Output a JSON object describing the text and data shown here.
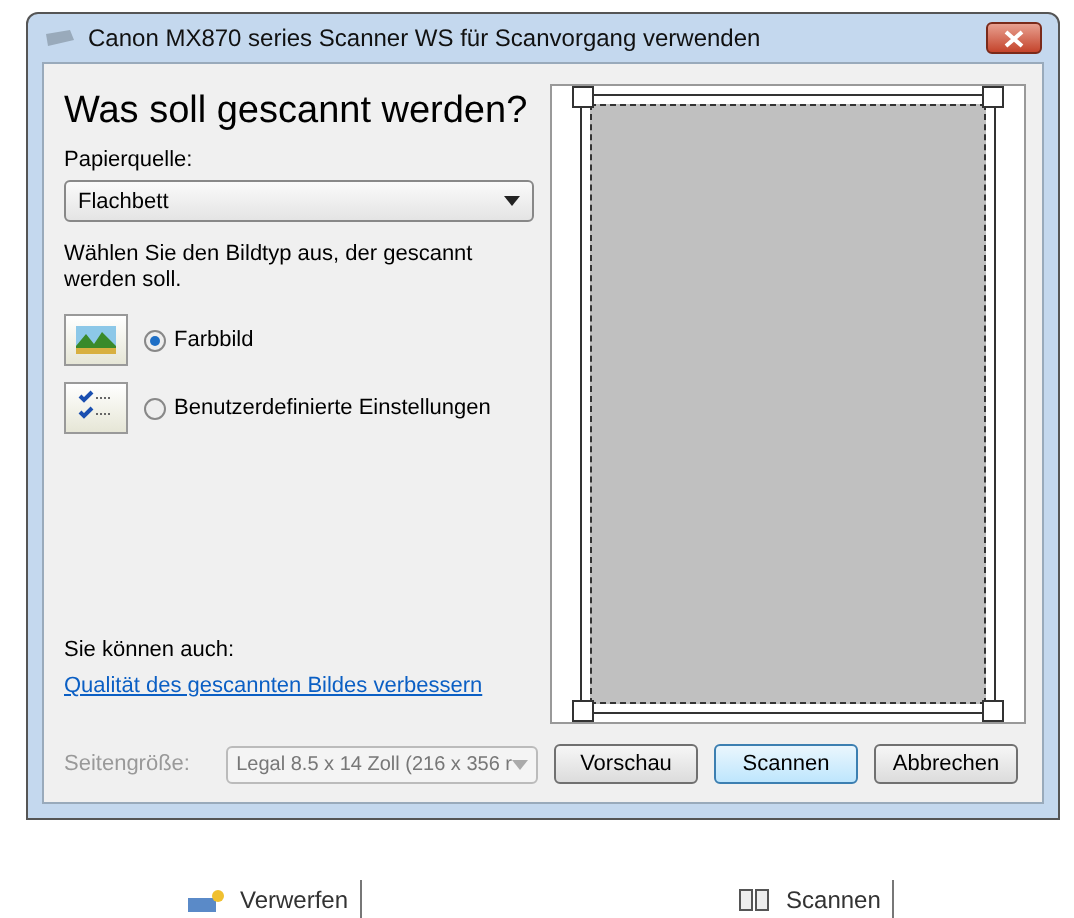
{
  "window": {
    "title": "Canon MX870 series Scanner WS für Scanvorgang verwenden"
  },
  "heading": "Was soll gescannt werden?",
  "paper_source": {
    "label": "Papierquelle:",
    "value": "Flachbett"
  },
  "instruction": "Wählen Sie den Bildtyp aus, der gescannt werden soll.",
  "image_types": [
    {
      "label": "Farbbild",
      "kind": "photo",
      "selected": true
    },
    {
      "label": "Benutzerdefinierte Einstellungen",
      "kind": "custom",
      "selected": false
    }
  ],
  "also": {
    "label": "Sie können auch:",
    "link": "Qualität des gescannten Bildes verbessern"
  },
  "page_size": {
    "label": "Seitengröße:",
    "value": "Legal 8.5 x 14 Zoll (216 x 356 r",
    "disabled": true
  },
  "buttons": [
    {
      "label": "Vorschau",
      "default": false
    },
    {
      "label": "Scannen",
      "default": true
    },
    {
      "label": "Abbrechen",
      "default": false
    }
  ],
  "toolbar": [
    {
      "label": "Verwerfen",
      "kind": "discard"
    },
    {
      "label": "Scannen",
      "kind": "scan"
    }
  ]
}
